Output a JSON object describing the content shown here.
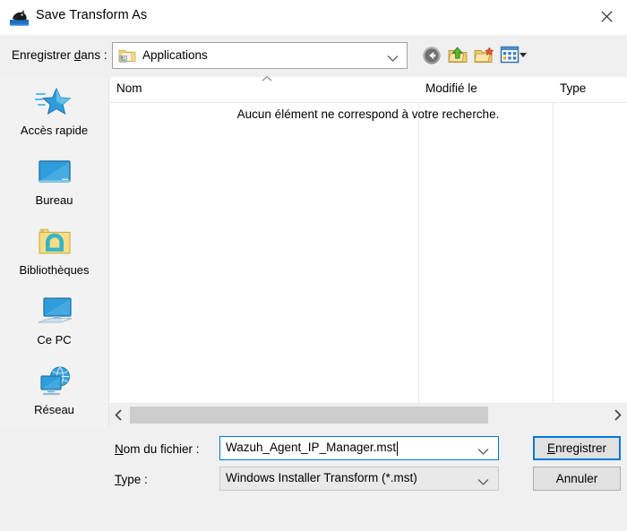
{
  "window": {
    "title": "Save Transform As",
    "icon": "orca-installer-icon",
    "close_label": "✕"
  },
  "lookin": {
    "label_pre": "Enregistrer ",
    "label_accel": "d",
    "label_post": "ans :",
    "value": "Applications",
    "icon": "folder-with-thumbnail-icon"
  },
  "toolbar": {
    "items": [
      {
        "name": "back-button",
        "tooltip": "Précédent"
      },
      {
        "name": "up-folder-button",
        "tooltip": "Remonter d'un niveau"
      },
      {
        "name": "new-folder-button",
        "tooltip": "Créer un dossier"
      },
      {
        "name": "views-button",
        "tooltip": "Affichages"
      }
    ]
  },
  "places": {
    "items": [
      {
        "label": "Accès rapide",
        "icon": "star-icon"
      },
      {
        "label": "Bureau",
        "icon": "monitor-icon"
      },
      {
        "label": "Bibliothèques",
        "icon": "library-folder-icon"
      },
      {
        "label": "Ce PC",
        "icon": "computer-icon"
      },
      {
        "label": "Réseau",
        "icon": "network-globe-icon"
      }
    ]
  },
  "filelist": {
    "columns": [
      {
        "label": "Nom",
        "sort": "ascending"
      },
      {
        "label": "Modifié le",
        "sort": "none"
      },
      {
        "label": "Type",
        "sort": "none"
      }
    ],
    "rows": [],
    "empty_message": "Aucun élément ne correspond à votre recherche."
  },
  "scrollbar": {
    "left_arrow": "‹",
    "right_arrow": "›"
  },
  "form": {
    "filename_label_accel": "N",
    "filename_label_post": "om du fichier :",
    "filename_value": "Wazuh_Agent_IP_Manager.mst",
    "filetype_label_accel": "T",
    "filetype_label_post": "ype :",
    "filetype_value": "Windows Installer Transform (*.mst)",
    "save_accel": "E",
    "save_post": "nregistrer",
    "cancel_label": "Annuler"
  },
  "colors": {
    "accent": "#0078d7",
    "dialog_bg": "#f0f0f0",
    "places_bg": "#f2f2f2",
    "list_bg": "#ffffff",
    "scroll_thumb": "#cdcdcd"
  }
}
